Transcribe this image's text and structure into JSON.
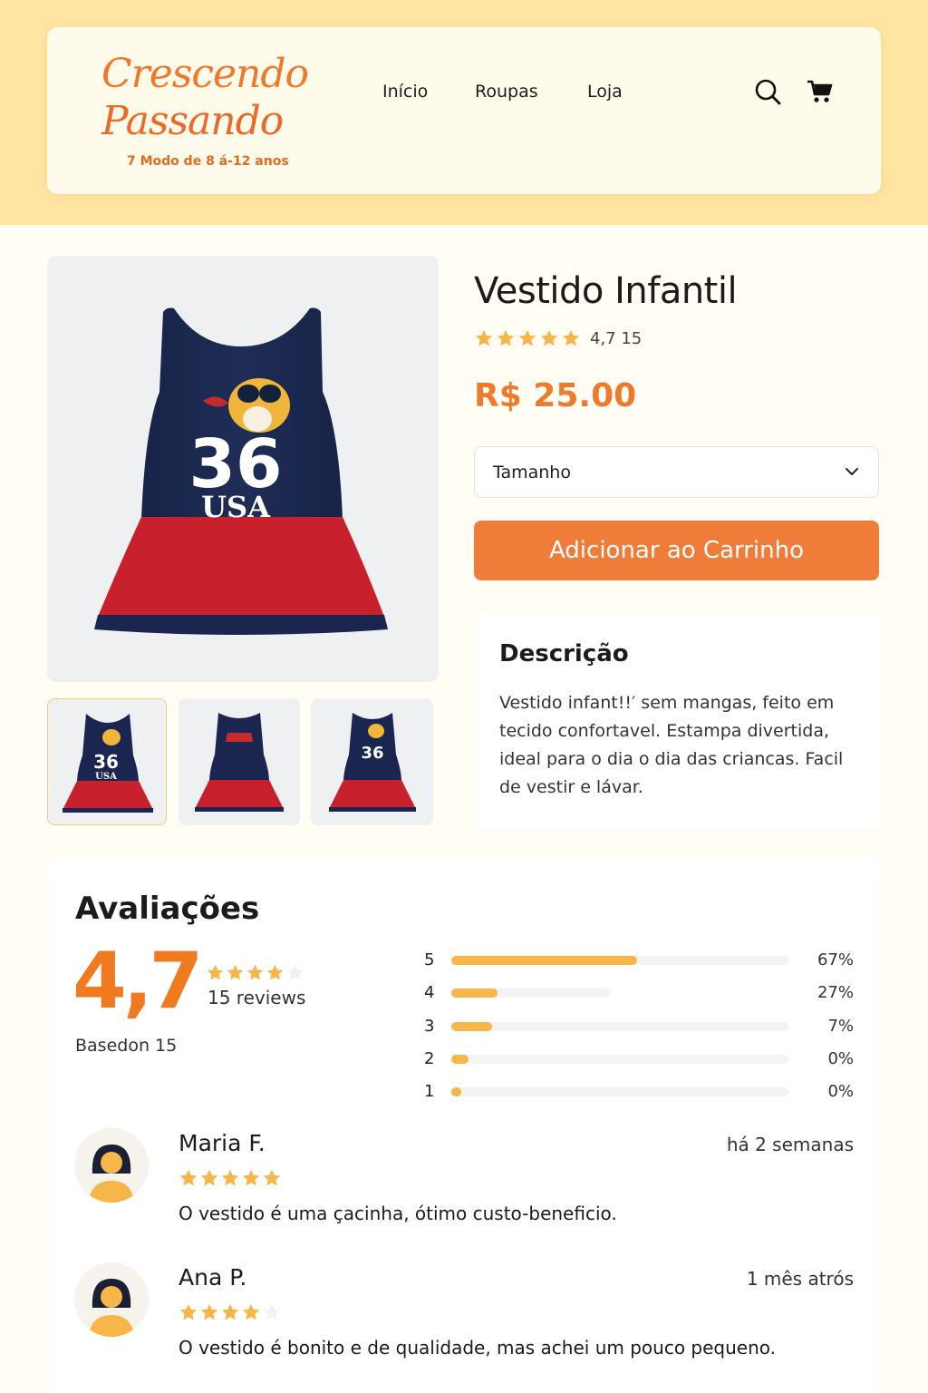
{
  "colors": {
    "accent": "#f07c3a",
    "price": "#ee7a2b",
    "star": "#f6b64a",
    "header_band": "#ffe4a2"
  },
  "brand": {
    "line1": "Crescendo",
    "line2": "Passando",
    "tagline": "7 Modo de 8 á-12 anos"
  },
  "nav": {
    "home": "Início",
    "clothes": "Roupas",
    "store": "Loja",
    "icons": [
      "search-icon",
      "cart-icon"
    ]
  },
  "product": {
    "title": "Vestido Infantil",
    "rating_text": "4,7 15",
    "rating": 4.7,
    "price": "R$ 25.00",
    "size_label": "Tamanho",
    "add_to_cart": "Adicionar ao Carrinho",
    "description_title": "Descrição",
    "description": "Vestido infant!!′ sem mangas, feito em tecido confortavel. Estampa divertida, ideal para o dia o dia das criancas. Facil de vestir e lávar."
  },
  "reviews": {
    "title": "Avaliações",
    "score": "4,7",
    "count_label": "15 reviews",
    "based_on": "Basedon 15",
    "summary_stars": 4,
    "distribution": [
      {
        "stars": "5",
        "pct": "67%",
        "fill": 0.55,
        "track": 1.0
      },
      {
        "stars": "4",
        "pct": "27%",
        "fill": 0.29,
        "track": 0.47
      },
      {
        "stars": "3",
        "pct": "7%",
        "fill": 0.12,
        "track": 1.0
      },
      {
        "stars": "2",
        "pct": "0%",
        "fill": 0.05,
        "track": 1.0
      },
      {
        "stars": "1",
        "pct": "0%",
        "fill": 0.03,
        "track": 1.0
      }
    ],
    "items": [
      {
        "name": "Maria F.",
        "date": "há 2 semanas",
        "stars": 5,
        "text": "O vestido é uma çacinha, ótimo custo-beneficio."
      },
      {
        "name": "Ana P.",
        "date": "1 mês atrós",
        "stars": 4,
        "text": "O vestido é bonito e de qualidade, mas achei um pouco pequeno."
      }
    ]
  },
  "dress_print": {
    "number": "36",
    "word": "USA"
  }
}
